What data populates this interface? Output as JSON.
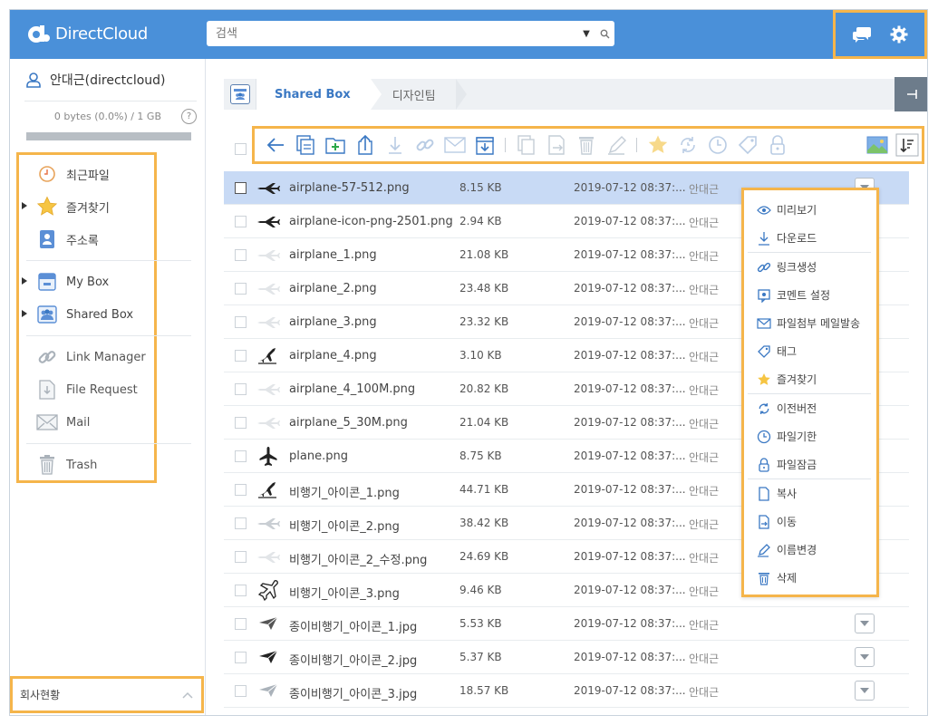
{
  "brand": {
    "name": "DirectCloud"
  },
  "search": {
    "placeholder": "검색"
  },
  "user": {
    "name": "안대근(directcloud)",
    "quota_text": "0 bytes (0.0%) / 1 GB",
    "help": "?"
  },
  "nav": {
    "recent": "최근파일",
    "favorites": "즐겨찾기",
    "contacts": "주소록",
    "mybox": "My Box",
    "sharedbox": "Shared Box",
    "link_manager": "Link Manager",
    "file_request": "File Request",
    "mail": "Mail",
    "trash": "Trash"
  },
  "company": {
    "label": "회사현황"
  },
  "breadcrumb": {
    "root": "Shared Box",
    "current": "디자인팀"
  },
  "files": [
    {
      "name": "airplane-57-512.png",
      "size": "8.15 KB",
      "date": "2019-07-12 08:37:...",
      "owner": "안대근",
      "icon": "airplane-icon"
    },
    {
      "name": "airplane-icon-png-2501.png",
      "size": "2.94 KB",
      "date": "2019-07-12 08:37:...",
      "owner": "안대근",
      "icon": "airplane-icon"
    },
    {
      "name": "airplane_1.png",
      "size": "21.08 KB",
      "date": "2019-07-12 08:37:...",
      "owner": "안대근",
      "icon": "airplane-faint-icon"
    },
    {
      "name": "airplane_2.png",
      "size": "23.48 KB",
      "date": "2019-07-12 08:37:...",
      "owner": "안대근",
      "icon": "airplane-faint-icon"
    },
    {
      "name": "airplane_3.png",
      "size": "23.32 KB",
      "date": "2019-07-12 08:37:...",
      "owner": "안대근",
      "icon": "airplane-faint-icon"
    },
    {
      "name": "airplane_4.png",
      "size": "3.10 KB",
      "date": "2019-07-12 08:37:...",
      "owner": "안대근",
      "icon": "airplane-takeoff-icon"
    },
    {
      "name": "airplane_4_100M.png",
      "size": "20.82 KB",
      "date": "2019-07-12 08:37:...",
      "owner": "안대근",
      "icon": "airplane-faint-icon"
    },
    {
      "name": "airplane_5_30M.png",
      "size": "21.04 KB",
      "date": "2019-07-12 08:37:...",
      "owner": "안대근",
      "icon": "airplane-faint-icon"
    },
    {
      "name": "plane.png",
      "size": "8.75 KB",
      "date": "2019-07-12 08:37:...",
      "owner": "안대근",
      "icon": "plane-icon"
    },
    {
      "name": "비행기_아이콘_1.png",
      "size": "44.71 KB",
      "date": "2019-07-12 08:37:...",
      "owner": "안대근",
      "icon": "airplane-takeoff-icon"
    },
    {
      "name": "비행기_아이콘_2.png",
      "size": "38.42 KB",
      "date": "2019-07-12 08:37:...",
      "owner": "안대근",
      "icon": "airplane-faint-icon"
    },
    {
      "name": "비행기_아이콘_2_수정.png",
      "size": "24.69 KB",
      "date": "2019-07-12 08:37:...",
      "owner": "안대근",
      "icon": "airplane-faint-icon"
    },
    {
      "name": "비행기_아이콘_3.png",
      "size": "9.46 KB",
      "date": "2019-07-12 08:37:...",
      "owner": "안대근",
      "icon": "airplane-outline-icon"
    },
    {
      "name": "종이비행기_아이콘_1.jpg",
      "size": "5.53 KB",
      "date": "2019-07-12 08:37:...",
      "owner": "안대근",
      "icon": "paper-plane-icon"
    },
    {
      "name": "종이비행기_아이콘_2.jpg",
      "size": "5.37 KB",
      "date": "2019-07-12 08:37:...",
      "owner": "안대근",
      "icon": "paper-plane-icon"
    },
    {
      "name": "종이비행기_아이콘_3.jpg",
      "size": "18.57 KB",
      "date": "2019-07-12 08:37:...",
      "owner": "안대근",
      "icon": "paper-plane-icon"
    }
  ],
  "context_menu": {
    "preview": "미리보기",
    "download": "다운로드",
    "create_link": "링크생성",
    "comment_settings": "코멘트 설정",
    "send_attachment_mail": "파일첨부 메일발송",
    "tag": "태그",
    "favorite": "즐겨찾기",
    "previous_version": "이전버전",
    "file_expiry": "파일기한",
    "file_lock": "파일잠금",
    "copy": "복사",
    "move": "이동",
    "rename": "이름변경",
    "delete": "삭제"
  },
  "colors": {
    "header": "#4a90d9",
    "highlight": "#f5b54b",
    "selected_row": "#c8daf5",
    "accent": "#3a78c3"
  }
}
